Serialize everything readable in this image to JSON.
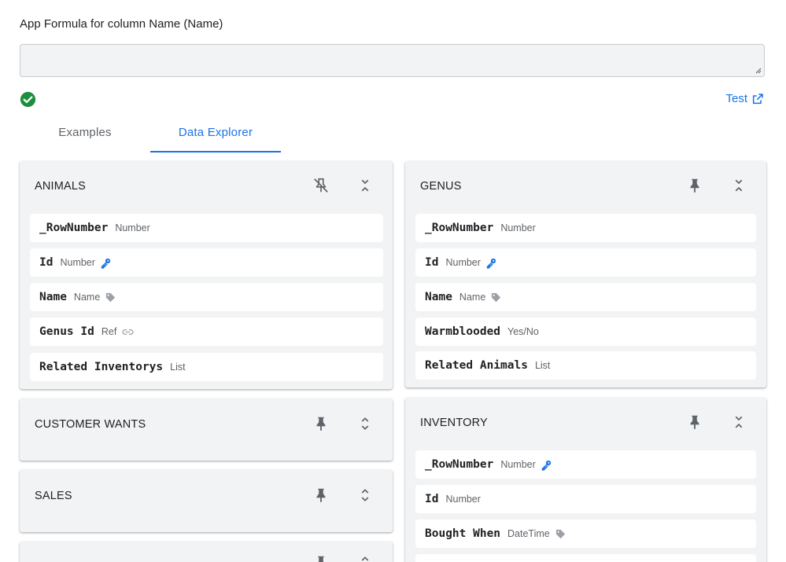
{
  "formula": {
    "label": "App Formula for column Name (Name)",
    "value": "",
    "status": "valid",
    "test_label": "Test"
  },
  "tabs": [
    {
      "label": "Examples",
      "active": false
    },
    {
      "label": "Data Explorer",
      "active": true
    }
  ],
  "tables": {
    "animals": {
      "title": "ANIMALS",
      "pinned": true,
      "expanded": true,
      "columns": [
        {
          "name": "_RowNumber",
          "type": "Number",
          "icon": ""
        },
        {
          "name": "Id",
          "type": "Number",
          "icon": "key-icon"
        },
        {
          "name": "Name",
          "type": "Name",
          "icon": "label-icon"
        },
        {
          "name": "Genus Id",
          "type": "Ref",
          "icon": "link-icon"
        },
        {
          "name": "Related Inventorys",
          "type": "List",
          "icon": ""
        }
      ]
    },
    "genus": {
      "title": "GENUS",
      "pinned": false,
      "expanded": true,
      "columns": [
        {
          "name": "_RowNumber",
          "type": "Number",
          "icon": ""
        },
        {
          "name": "Id",
          "type": "Number",
          "icon": "key-icon"
        },
        {
          "name": "Name",
          "type": "Name",
          "icon": "label-icon"
        },
        {
          "name": "Warmblooded",
          "type": "Yes/No",
          "icon": ""
        },
        {
          "name": "Related Animals",
          "type": "List",
          "icon": ""
        }
      ]
    },
    "customer_wants": {
      "title": "CUSTOMER WANTS",
      "pinned": false,
      "expanded": false
    },
    "sales": {
      "title": "SALES",
      "pinned": false,
      "expanded": false
    },
    "inventory": {
      "title": "INVENTORY",
      "pinned": false,
      "expanded": true,
      "columns": [
        {
          "name": "_RowNumber",
          "type": "Number",
          "icon": "key-icon"
        },
        {
          "name": "Id",
          "type": "Number",
          "icon": ""
        },
        {
          "name": "Bought When",
          "type": "DateTime",
          "icon": "label-icon"
        }
      ]
    }
  },
  "colors": {
    "accent": "#1a73e8",
    "success": "#1e8e3e",
    "card_bg": "#f1f3f4",
    "icon_gray": "#5f6368"
  }
}
